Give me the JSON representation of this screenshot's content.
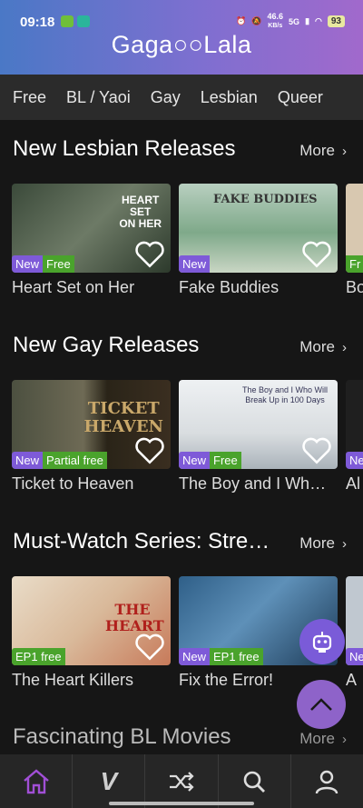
{
  "status_bar": {
    "time": "09:18",
    "net_speed_top": "46.6",
    "net_speed_unit": "KB/s",
    "signal": "5G",
    "battery": "93"
  },
  "app": {
    "logo_text": "Gaga○○Lala"
  },
  "tabs": [
    "Free",
    "BL / Yaoi",
    "Gay",
    "Lesbian",
    "Queer"
  ],
  "sections": [
    {
      "title": "New Lesbian Releases",
      "more": "More",
      "cards": [
        {
          "title": "Heart Set on Her",
          "poster_text": "HEART\nSET\nON HER",
          "badges": [
            "New",
            "Free"
          ]
        },
        {
          "title": "Fake Buddies",
          "poster_text": "FAKE BUDDIES",
          "badges": [
            "New"
          ]
        },
        {
          "title": "Bo",
          "badges": [
            "Fr"
          ]
        }
      ]
    },
    {
      "title": "New Gay Releases",
      "more": "More",
      "cards": [
        {
          "title": "Ticket to Heaven",
          "poster_text": "TICKET\nHEAVEN",
          "badges": [
            "New",
            "Partial free"
          ]
        },
        {
          "title": "The Boy and I Wh…",
          "poster_text": "The Boy and I Who Will Break Up in 100 Days",
          "badges": [
            "New",
            "Free"
          ]
        },
        {
          "title": "Al",
          "badges": [
            "Ne"
          ]
        }
      ]
    },
    {
      "title": "Must-Watch Series: Stre…",
      "more": "More",
      "cards": [
        {
          "title": "The Heart Killers",
          "poster_text": "THE HEART",
          "badges": [
            "EP1 free"
          ]
        },
        {
          "title": "Fix the Error!",
          "poster_text": "",
          "badges": [
            "New",
            "EP1 free"
          ]
        },
        {
          "title": "A",
          "badges": [
            "Ne"
          ]
        }
      ]
    },
    {
      "title": "Fascinating BL Movies",
      "more": "More"
    }
  ],
  "bottom_nav": [
    {
      "name": "home",
      "icon": "home-icon",
      "active": true
    },
    {
      "name": "v",
      "icon": "v-logo-icon",
      "label": "V"
    },
    {
      "name": "shuffle",
      "icon": "shuffle-icon"
    },
    {
      "name": "search",
      "icon": "search-icon"
    },
    {
      "name": "profile",
      "icon": "profile-icon"
    }
  ],
  "colors": {
    "accent": "#8e63c9",
    "new_badge": "#7e5ad8",
    "free_badge": "#4aa32c",
    "home_active": "#a14fd6"
  }
}
